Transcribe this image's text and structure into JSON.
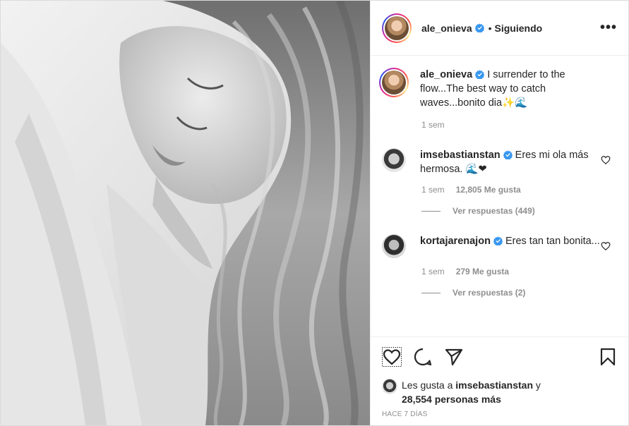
{
  "post": {
    "author": "ale_onieva",
    "follow_status": "Siguiendo",
    "separator": "•",
    "more_label": "•••",
    "photo_alt": ""
  },
  "caption": {
    "username": "ale_onieva",
    "text": "I surrender to the flow...The best way to catch waves...bonito dia✨🌊",
    "time": "1 sem"
  },
  "comments": [
    {
      "username": "imsebastianstan",
      "text": "Eres mi ola más hermosa. 🌊❤",
      "time": "1 sem",
      "likes": "12,805 Me gusta",
      "replies": "Ver respuestas (449)"
    },
    {
      "username": "kortajarenajon",
      "text": "Eres tan tan bonita...",
      "time": "1 sem",
      "likes": "279 Me gusta",
      "replies": "Ver respuestas (2)"
    }
  ],
  "likes": {
    "prefix": "Les gusta a",
    "user": "imsebastianstan",
    "and": "y",
    "others": "28,554 personas más"
  },
  "timestamp": "Hace 7 días",
  "colors": {
    "verified": "#3897f0",
    "muted": "#8e8e8e",
    "text": "#262626"
  },
  "icons": [
    "more-options-icon",
    "verified-badge-icon",
    "like-icon",
    "comment-icon",
    "share-icon",
    "save-icon"
  ]
}
